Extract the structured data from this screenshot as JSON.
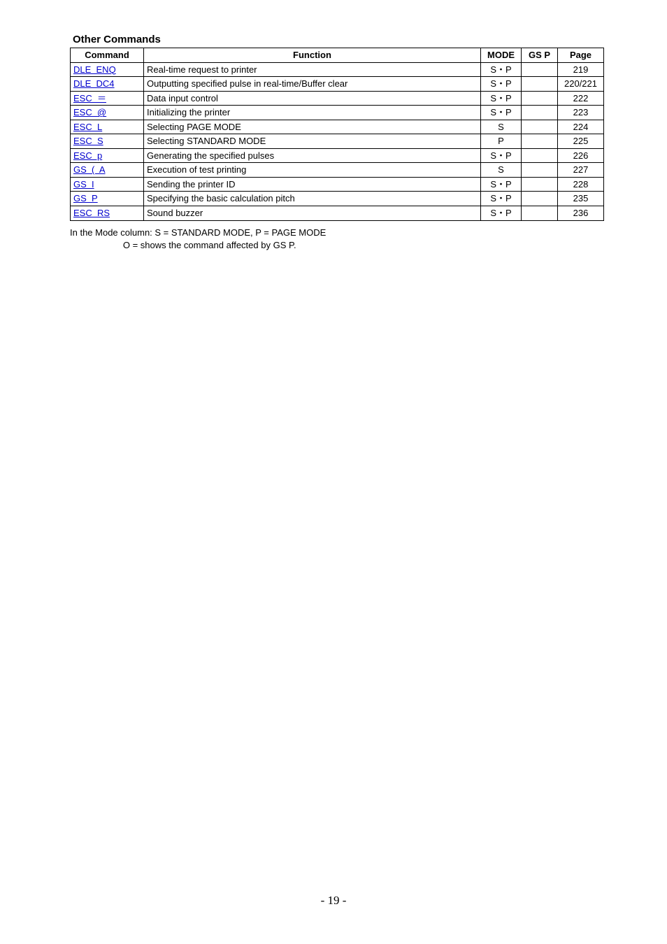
{
  "section_title": "Other Commands",
  "headers": {
    "cmd": "Command",
    "func": "Function",
    "mode": "MODE",
    "gsp": "GS P",
    "page": "Page"
  },
  "rows": [
    {
      "cmd": "DLE  ENQ",
      "func": "Real-time request to printer",
      "mode": "S・P",
      "gsp": "",
      "page": "219"
    },
    {
      "cmd": "DLE  DC4",
      "func": "Outputting specified pulse in real-time/Buffer clear",
      "mode": "S・P",
      "gsp": "",
      "page": "220/221"
    },
    {
      "cmd": "ESC  ＝",
      "func": "Data input control",
      "mode": "S・P",
      "gsp": "",
      "page": "222"
    },
    {
      "cmd": "ESC  @",
      "func": "Initializing the printer",
      "mode": "S・P",
      "gsp": "",
      "page": "223"
    },
    {
      "cmd": "ESC  L",
      "func": "Selecting PAGE MODE",
      "mode": "S",
      "gsp": "",
      "page": "224"
    },
    {
      "cmd": "ESC  S",
      "func": "Selecting STANDARD MODE",
      "mode": "P",
      "gsp": "",
      "page": "225"
    },
    {
      "cmd": "ESC  p",
      "func": "Generating the specified pulses",
      "mode": "S・P",
      "gsp": "",
      "page": "226"
    },
    {
      "cmd": "GS  (  A",
      "func": "Execution of test printing",
      "mode": "S",
      "gsp": "",
      "page": "227"
    },
    {
      "cmd": "GS  I",
      "func": "Sending the printer ID",
      "mode": "S・P",
      "gsp": "",
      "page": "228"
    },
    {
      "cmd": "GS  P",
      "func": "Specifying the basic calculation pitch",
      "mode": "S・P",
      "gsp": "",
      "page": "235"
    },
    {
      "cmd": "ESC  RS",
      "func": "Sound buzzer",
      "mode": "S・P",
      "gsp": "",
      "page": "236"
    }
  ],
  "note_line1": "In the Mode column: S = STANDARD MODE, P = PAGE MODE",
  "note_line2": "                     O = shows the command affected by GS P.",
  "page_number": "- 19 -"
}
